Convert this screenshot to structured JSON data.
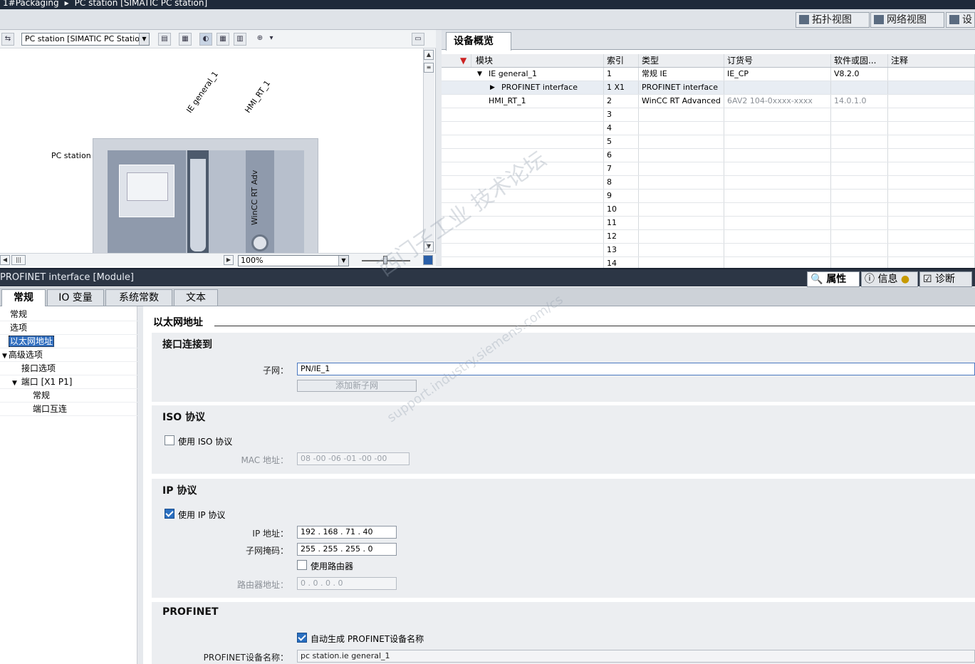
{
  "titlebar": {
    "project": "1#Packaging",
    "station": "PC station [SIMATIC PC station]"
  },
  "view_tabs": [
    "拓扑视图",
    "网络视图",
    "设"
  ],
  "editor": {
    "device_select": "PC station [SIMATIC PC Station]",
    "pc_label": "PC station",
    "module_ie": "IE general_1",
    "module_hmi": "HMI_RT_1",
    "hmi_card_text": "WinCC RT Adv",
    "zoom": "100%"
  },
  "overview": {
    "tab": "设备概览",
    "columns": [
      "模块",
      "索引",
      "类型",
      "订货号",
      "软件或固...",
      "注释"
    ],
    "rows": [
      {
        "module": "IE general_1",
        "index": "1",
        "type": "常规 IE",
        "order": "IE_CP",
        "fw": "V8.2.0"
      },
      {
        "module": "PROFINET interface",
        "index": "1 X1",
        "type": "PROFINET interface",
        "order": "",
        "fw": ""
      },
      {
        "module": "HMI_RT_1",
        "index": "2",
        "type": "WinCC RT Advanced",
        "order": "6AV2 104-0xxxx-xxxx",
        "fw": "14.0.1.0"
      },
      {
        "module": "",
        "index": "3"
      },
      {
        "module": "",
        "index": "4"
      },
      {
        "module": "",
        "index": "5"
      },
      {
        "module": "",
        "index": "6"
      },
      {
        "module": "",
        "index": "7"
      },
      {
        "module": "",
        "index": "8"
      },
      {
        "module": "",
        "index": "9"
      },
      {
        "module": "",
        "index": "10"
      },
      {
        "module": "",
        "index": "11"
      },
      {
        "module": "",
        "index": "12"
      },
      {
        "module": "",
        "index": "13"
      },
      {
        "module": "",
        "index": "14"
      }
    ]
  },
  "props": {
    "title": "PROFINET interface [Module]",
    "tabs": [
      "属性",
      "信息",
      "诊断"
    ],
    "subtabs": [
      "常规",
      "IO 变量",
      "系统常数",
      "文本"
    ],
    "nav": [
      "常规",
      "选项",
      "以太网地址",
      "高级选项",
      "接口选项",
      "端口 [X1 P1]",
      "常规",
      "端口互连"
    ]
  },
  "ethernet": {
    "title": "以太网地址",
    "interface_section": "接口连接到",
    "subnet_label": "子网：",
    "subnet_value": "PN/IE_1",
    "add_subnet": "添加新子网",
    "iso_section": "ISO 协议",
    "use_iso": "使用 ISO 协议",
    "mac_label": "MAC 地址：",
    "mac_value": "08 -00 -06 -01 -00 -00",
    "ip_section": "IP 协议",
    "use_ip": "使用 IP 协议",
    "ip_label": "IP 地址：",
    "ip_value": "192 . 168 . 71   . 40",
    "mask_label": "子网掩码：",
    "mask_value": "255 . 255 . 255 . 0",
    "use_router": "使用路由器",
    "router_label": "路由器地址：",
    "router_value": "0    . 0    . 0    . 0",
    "profinet_section": "PROFINET",
    "auto_name": "自动生成 PROFINET设备名称",
    "pn_name_label": "PROFINET设备名称：",
    "pn_name_value": "pc station.ie general_1"
  },
  "watermark": {
    "line1": "西门子工业 技术论坛",
    "line2": "support.industry.siemens.com/cs"
  }
}
